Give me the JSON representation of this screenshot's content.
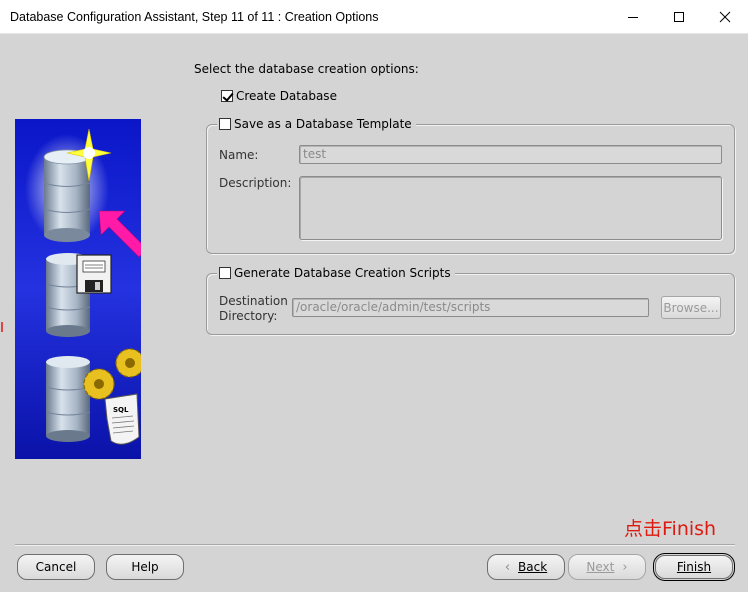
{
  "window": {
    "title": "Database Configuration Assistant, Step 11 of 11 : Creation Options",
    "controls": {
      "minimize": "minimize-icon",
      "maximize": "maximize-icon",
      "close": "close-icon"
    }
  },
  "main": {
    "prompt": "Select the database creation options:",
    "create_database": {
      "label": "Create Database",
      "checked": true
    },
    "save_template": {
      "label": "Save as a Database Template",
      "checked": false,
      "name_label": "Name:",
      "name_value": "test",
      "description_label": "Description:",
      "description_value": ""
    },
    "generate_scripts": {
      "label": "Generate Database Creation Scripts",
      "checked": false,
      "dest_label_line1": "Destination",
      "dest_label_line2": "Directory:",
      "dest_value": "/oracle/oracle/admin/test/scripts",
      "browse_label": "Browse..."
    }
  },
  "buttons": {
    "cancel": "Cancel",
    "help": "Help",
    "back": "Back",
    "next": "Next",
    "finish": "Finish"
  },
  "annotation": "点击Finish",
  "colors": {
    "background": "#d4d4d4",
    "annotation": "#e0190e",
    "art_blue": "#1a2ad8"
  }
}
